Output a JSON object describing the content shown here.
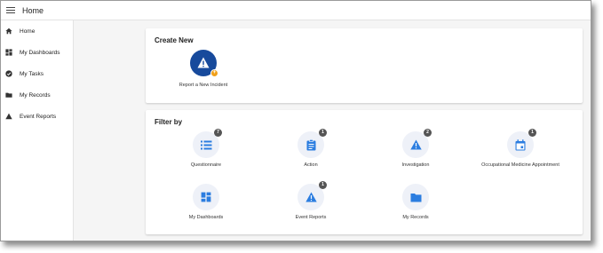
{
  "app": {
    "title": "Home"
  },
  "sidebar": {
    "items": [
      {
        "label": "Home",
        "icon": "home-icon"
      },
      {
        "label": "My Dashboards",
        "icon": "dashboard-icon"
      },
      {
        "label": "My Tasks",
        "icon": "check-circle-icon"
      },
      {
        "label": "My Records",
        "icon": "folder-icon"
      },
      {
        "label": "Event Reports",
        "icon": "warning-icon"
      }
    ]
  },
  "create_new": {
    "title": "Create New",
    "action": {
      "label": "Report a New Incident",
      "icon": "warning-icon"
    }
  },
  "filter_by": {
    "title": "Filter by",
    "tiles": [
      {
        "label": "Questionnaire",
        "count": "7",
        "icon": "list-icon"
      },
      {
        "label": "Action",
        "count": "1",
        "icon": "clipboard-icon"
      },
      {
        "label": "Investigation",
        "count": "2",
        "icon": "warning-icon"
      },
      {
        "label": "Occupational Medicine Appointment",
        "count": "1",
        "icon": "calendar-icon"
      },
      {
        "label": "My Dashboards",
        "icon": "dashboard-icon"
      },
      {
        "label": "Event Reports",
        "count": "1",
        "icon": "warning-icon"
      },
      {
        "label": "My Records",
        "icon": "folder-icon"
      }
    ]
  },
  "colors": {
    "primary": "#174a9c",
    "icon_blue": "#2b7de0",
    "accent": "#f0a01a",
    "badge": "#555555"
  }
}
